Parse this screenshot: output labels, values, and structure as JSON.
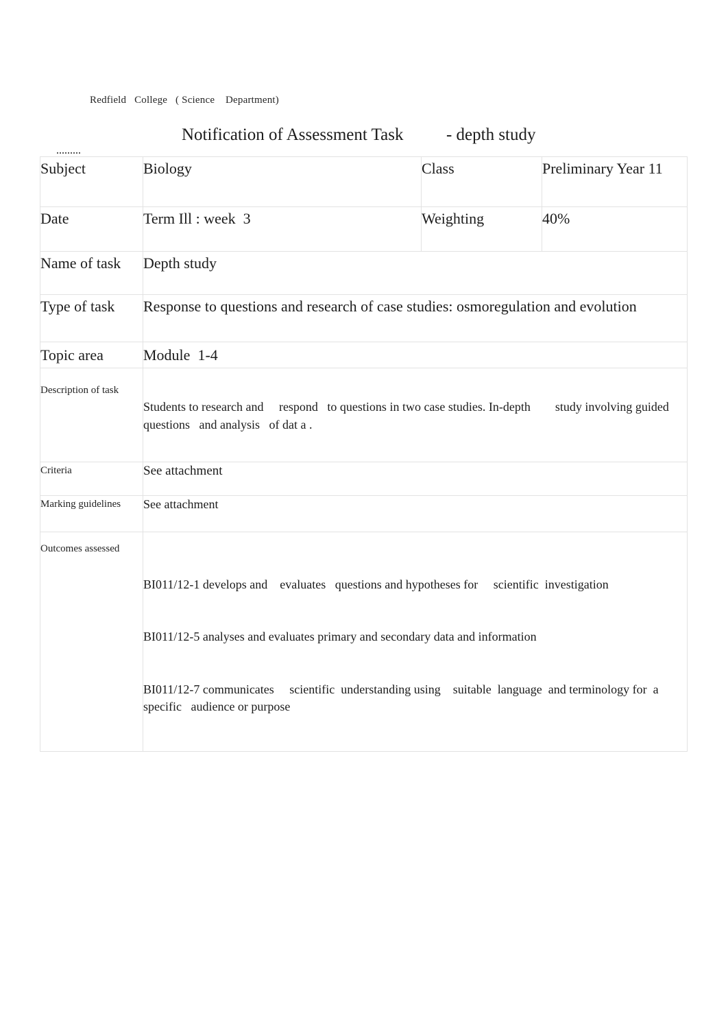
{
  "document": {
    "school_line": "Redfield   College   ( Science    Department)",
    "title": "Notification of Assessment Task          - depth study"
  },
  "table": {
    "rows": [
      {
        "label": "Subject",
        "value": "Biology",
        "label2": "Class",
        "value2": "Preliminary Year 11"
      },
      {
        "label": "Date",
        "value": "Term Ill : week  3",
        "label2": "Weighting",
        "value2": "40%"
      }
    ],
    "name_of_task": {
      "label": "Name of task",
      "value": "Depth study"
    },
    "type_of_task": {
      "label": "Type of task",
      "value": "Response to questions and research of case studies: osmoregulation and evolution"
    },
    "topic_area": {
      "label": "Topic area",
      "value": "Module  1-4"
    },
    "description_of_task": {
      "label": "Description of task",
      "value": "Students to research and     respond   to questions in two case studies. In-depth        study involving guided  questions   and analysis   of dat a ."
    },
    "criteria": {
      "label": "Criteria",
      "value": "See attachment"
    },
    "marking_guidelines": {
      "label": "Marking guidelines",
      "value": "See attachment"
    },
    "outcomes_assessed": {
      "label": "Outcomes assessed",
      "line1": "BI011/12-1 develops and    evaluates   questions and hypotheses for     scientific  investigation",
      "line2": "BI011/12-5 analyses and evaluates primary and secondary data and information",
      "line3": "BI011/12-7 communicates     scientific  understanding using    suitable  language  and terminology for  a specific   audience or purpose"
    }
  }
}
